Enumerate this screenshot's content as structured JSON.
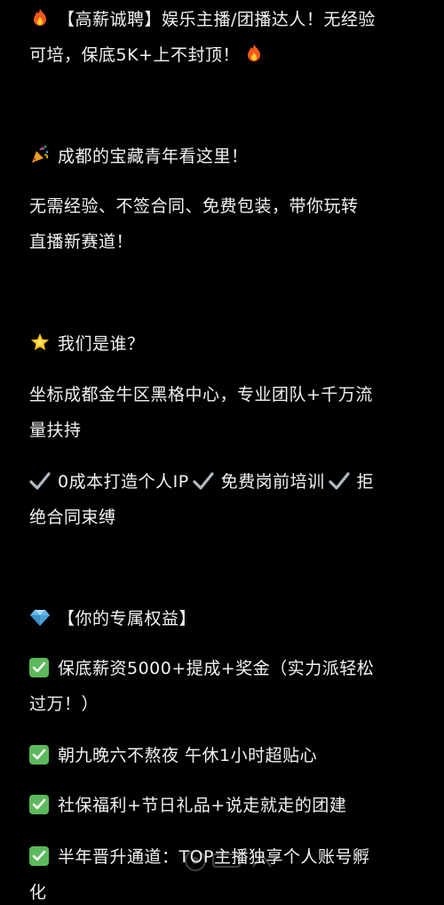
{
  "post": {
    "title_line1": "【高薪诚聘】娱乐主播/团播达人！无经验",
    "title_line2": "可培，保底5K+上不封顶！",
    "section1_heading": "成都的宝藏青年看这里！",
    "section1_body_line1": "无需经验、不签合同、免费包装，带你玩转",
    "section1_body_line2": "直播新赛道！",
    "section2_heading": "我们是谁？",
    "section2_body_line1": "坐标成都金牛区黑格中心，专业团队+千万流",
    "section2_body_line2": "量扶持",
    "features": {
      "item1": "0成本打造个人IP",
      "item2": "免费岗前培训",
      "item3_part1": "拒",
      "item3_part2": "绝合同束缚"
    },
    "section3_heading": "【你的专属权益】",
    "benefits": [
      {
        "line1": "保底薪资5000+提成+奖金（实力派轻松",
        "line2": "过万！）"
      },
      {
        "line1": "朝九晚六不熬夜 午休1小时超贴心"
      },
      {
        "line1": "社保福利+节日礼品+说走就走的团建"
      },
      {
        "line1": "半年晋升通道：TOP主播独享个人账号孵",
        "line2": "化"
      }
    ]
  },
  "icons": [
    "fire-icon",
    "party-popper-icon",
    "star-icon",
    "gem-icon",
    "check-mark-icon",
    "check-box-icon"
  ],
  "colors": {
    "background": "#000000",
    "text": "#f2f2f2",
    "check_box": "#5cb85c",
    "check_mark": "#b0b8c0"
  }
}
